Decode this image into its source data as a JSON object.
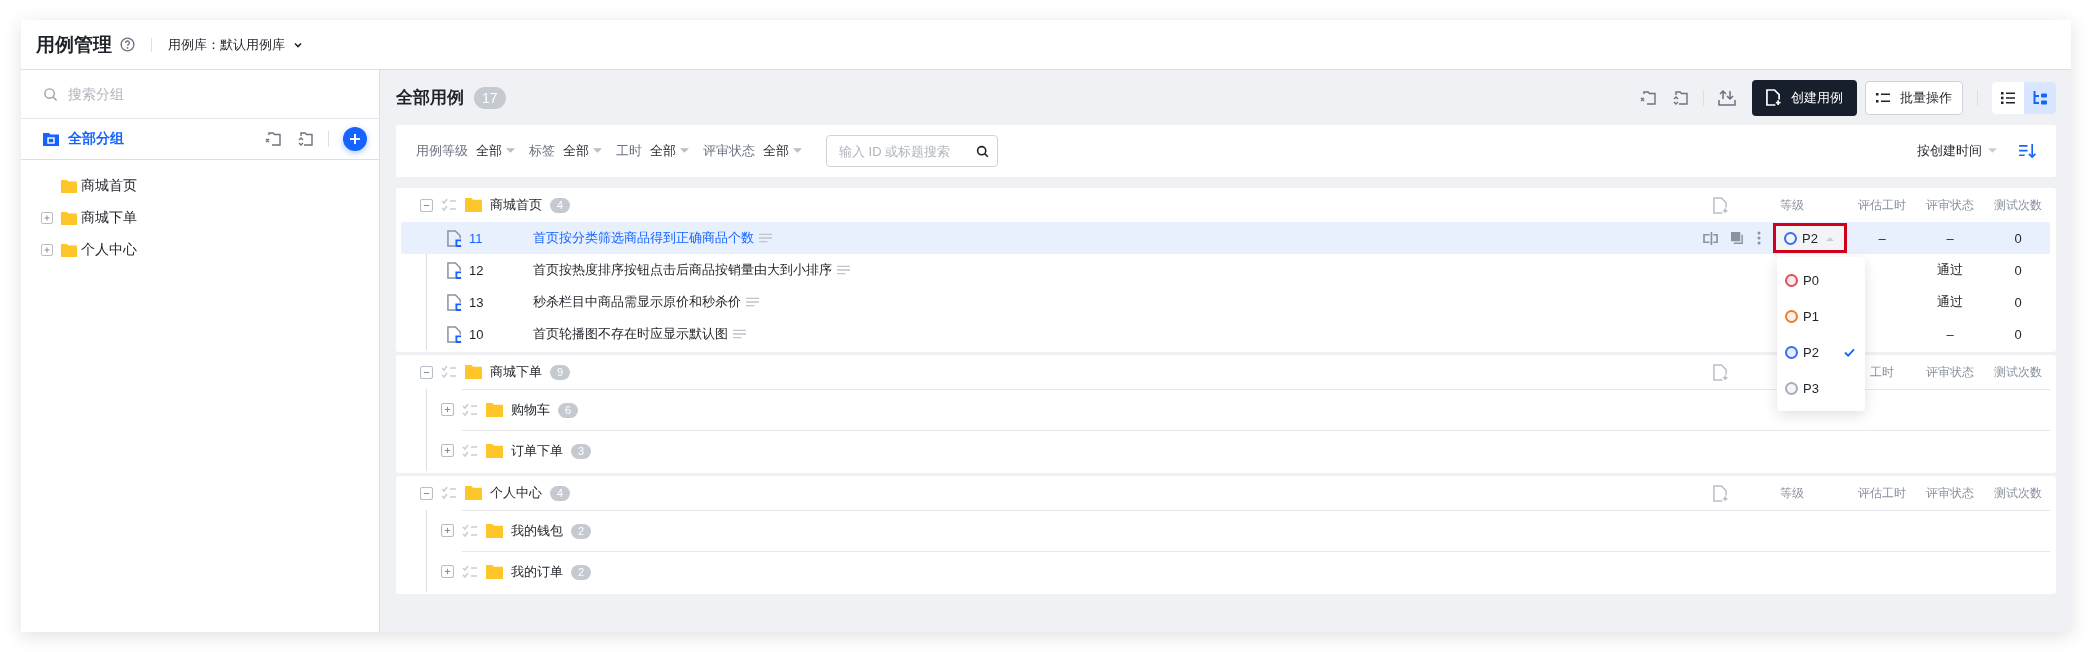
{
  "header": {
    "title": "用例管理",
    "library_label": "用例库：",
    "library": "默认用例库"
  },
  "sidebar": {
    "search": {
      "placeholder": "搜索分组"
    },
    "root": {
      "label": "全部分组",
      "selected": true
    },
    "tree": [
      {
        "label": "商城首页",
        "expandable": false
      },
      {
        "label": "商城下单",
        "expandable": true
      },
      {
        "label": "个人中心",
        "expandable": true
      }
    ]
  },
  "main": {
    "title": "全部用例",
    "count": "17",
    "create_button": "创建用例",
    "batch_button": "批量操作",
    "view_modes": [
      {
        "kind": "list",
        "selected": false
      },
      {
        "kind": "tree",
        "selected": true
      }
    ],
    "filters": [
      {
        "label": "用例等级",
        "value": "全部"
      },
      {
        "label": "标签",
        "value": "全部"
      },
      {
        "label": "工时",
        "value": "全部"
      },
      {
        "label": "评审状态",
        "value": "全部"
      }
    ],
    "search": {
      "placeholder": "输入 ID 或标题搜索"
    },
    "sort": {
      "label": "按创建时间"
    }
  },
  "groups": [
    {
      "name": "商城首页",
      "count": "4",
      "expanded": true,
      "columns": {
        "level": "等级",
        "estimate": "评估工时",
        "review": "评审状态",
        "runs": "测试次数"
      },
      "cases": [
        {
          "id": "11",
          "title": "首页按分类筛选商品得到正确商品个数",
          "selected": true,
          "level": {
            "label": "P2",
            "color": "#366ef4",
            "open": true,
            "annotated": true
          },
          "estimate": "–",
          "review": "–",
          "runs": "0"
        },
        {
          "id": "12",
          "title": "首页按热度排序按钮点击后商品按销量由大到小排序",
          "selected": false,
          "review": "通过",
          "runs": "0"
        },
        {
          "id": "13",
          "title": "秒杀栏目中商品需显示原价和秒杀价",
          "selected": false,
          "review": "通过",
          "runs": "0"
        },
        {
          "id": "10",
          "title": "首页轮播图不存在时应显示默认图",
          "selected": false,
          "review": "–",
          "runs": "0"
        }
      ]
    },
    {
      "name": "商城下单",
      "count": "9",
      "expanded": true,
      "columns": {
        "estimate": "工时",
        "review": "评审状态",
        "runs": "测试次数"
      },
      "children": [
        {
          "name": "购物车",
          "count": "6",
          "expanded": false
        },
        {
          "name": "订单下单",
          "count": "3",
          "expanded": false
        }
      ]
    },
    {
      "name": "个人中心",
      "count": "4",
      "expanded": true,
      "columns": {
        "level": "等级",
        "estimate": "评估工时",
        "review": "评审状态",
        "runs": "测试次数"
      },
      "children": [
        {
          "name": "我的钱包",
          "count": "2",
          "expanded": false
        },
        {
          "name": "我的订单",
          "count": "2",
          "expanded": false
        }
      ]
    }
  ],
  "level_dropdown": {
    "options": [
      {
        "label": "P0",
        "color": "#e34d59",
        "selected": false
      },
      {
        "label": "P1",
        "color": "#ed7b2f",
        "selected": false
      },
      {
        "label": "P2",
        "color": "#366ef4",
        "selected": true
      },
      {
        "label": "P3",
        "color": "#a6acb9",
        "selected": false
      }
    ]
  }
}
